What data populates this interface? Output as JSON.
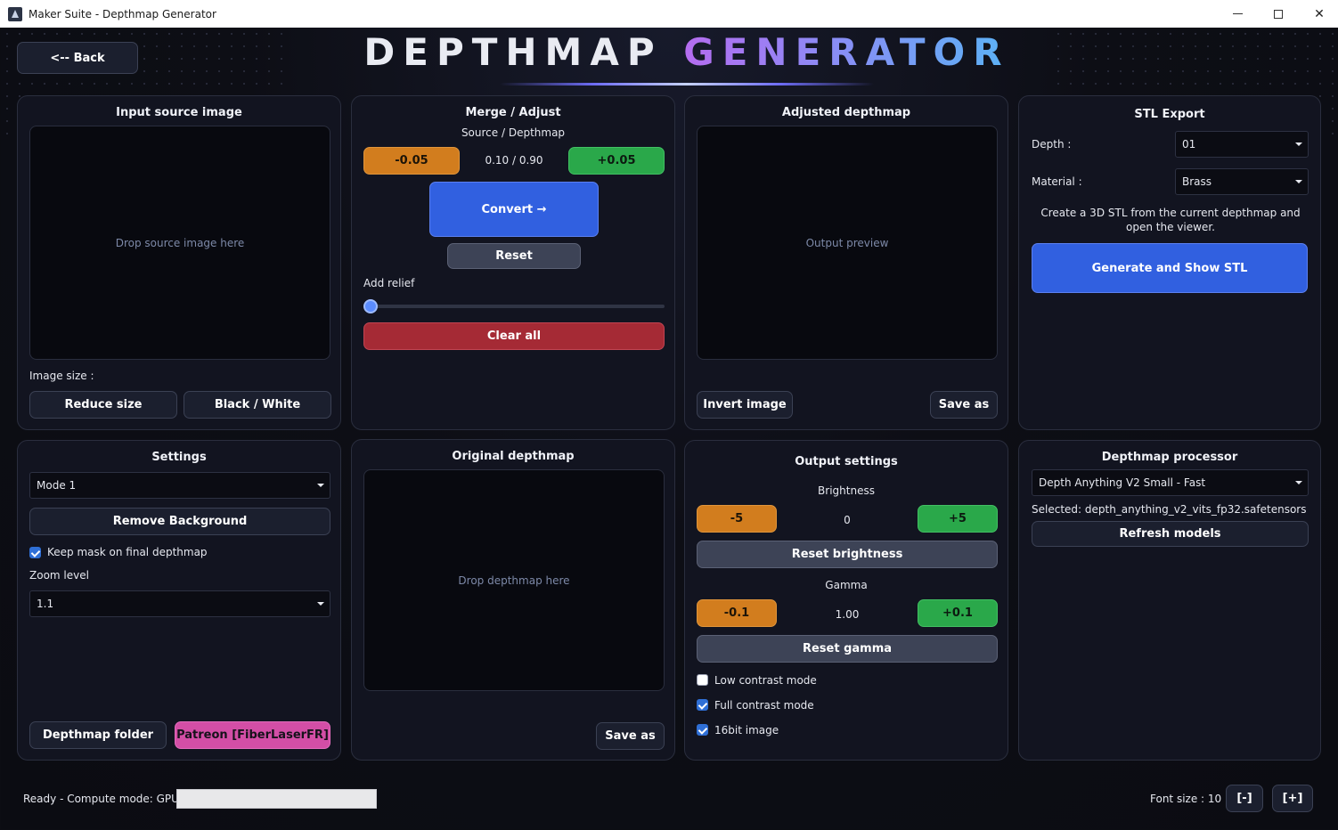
{
  "window": {
    "title": "Maker Suite - Depthmap Generator"
  },
  "header": {
    "title_word1": "DEPTHMAP",
    "title_word2": "GENERATOR",
    "back_label": "<-- Back"
  },
  "input_panel": {
    "title": "Input source image",
    "drop_text": "Drop source image here",
    "image_size_label": "Image size :",
    "reduce_size_label": "Reduce size",
    "black_white_label": "Black / White"
  },
  "merge_panel": {
    "title": "Merge / Adjust",
    "subtitle": "Source / Depthmap",
    "minus_label": "-0.05",
    "ratio_value": "0.10 / 0.90",
    "plus_label": "+0.05",
    "convert_label": "Convert →",
    "reset_label": "Reset",
    "relief_label": "Add relief",
    "relief_value": 0,
    "clear_label": "Clear all"
  },
  "adjusted_panel": {
    "title": "Adjusted depthmap",
    "preview_text": "Output preview",
    "invert_label": "Invert image",
    "save_label": "Save as"
  },
  "stl_panel": {
    "title": "STL Export",
    "depth_label": "Depth :",
    "depth_value": "01",
    "material_label": "Material :",
    "material_value": "Brass",
    "description": "Create a 3D STL from the current depthmap and open the viewer.",
    "generate_label": "Generate and Show STL"
  },
  "settings_panel": {
    "title": "Settings",
    "mode_value": "Mode 1",
    "remove_bg_label": "Remove Background",
    "keep_mask_label": "Keep mask on final depthmap",
    "keep_mask_checked": true,
    "zoom_label": "Zoom level",
    "zoom_value": "1.1",
    "folder_label": "Depthmap folder",
    "patreon_label": "Patreon [FiberLaserFR]"
  },
  "original_panel": {
    "title": "Original depthmap",
    "drop_text": "Drop depthmap here",
    "save_label": "Save as"
  },
  "output_panel": {
    "title": "Output settings",
    "brightness_label": "Brightness",
    "brightness_minus": "-5",
    "brightness_value": "0",
    "brightness_plus": "+5",
    "reset_brightness_label": "Reset brightness",
    "gamma_label": "Gamma",
    "gamma_minus": "-0.1",
    "gamma_value": "1.00",
    "gamma_plus": "+0.1",
    "reset_gamma_label": "Reset gamma",
    "low_contrast_label": "Low contrast mode",
    "low_contrast_checked": false,
    "full_contrast_label": "Full contrast mode",
    "full_contrast_checked": true,
    "bit16_label": "16bit image",
    "bit16_checked": true
  },
  "processor_panel": {
    "title": "Depthmap processor",
    "model_value": "Depth Anything V2 Small - Fast",
    "selected_text": "Selected: depth_anything_v2_vits_fp32.safetensors",
    "refresh_label": "Refresh models"
  },
  "status_bar": {
    "status_text": "Ready - Compute mode: GPU",
    "progress": 0,
    "font_size_label": "Font size : 10",
    "font_minus_label": "[-]",
    "font_plus_label": "[+]"
  },
  "colors": {
    "accent_blue": "#3160e0",
    "orange": "#d27d1e",
    "green": "#2aa84a",
    "red": "#a52a35",
    "pink": "#d34ea6",
    "panel_bg": "#121420"
  }
}
